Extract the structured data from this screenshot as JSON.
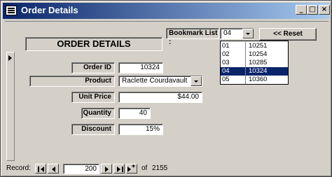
{
  "window": {
    "title": "Order Details",
    "minimize_glyph": "_",
    "maximize_glyph": "□",
    "close_glyph": "×"
  },
  "form": {
    "heading": "ORDER DETAILS",
    "fields": {
      "order_id": {
        "label": "Order ID",
        "value": "10324"
      },
      "product": {
        "label": "Product",
        "value": "Raclette Courdavault"
      },
      "unit_price": {
        "label": "Unit Price",
        "value": "$44.00"
      },
      "quantity": {
        "label": "Quantity",
        "value": "40"
      },
      "discount": {
        "label": "Discount",
        "value": "15%"
      }
    }
  },
  "bookmark": {
    "label": "Bookmark List :",
    "selected": "04",
    "reset_label": "<< Reset",
    "options": [
      {
        "num": "01",
        "order": "10251"
      },
      {
        "num": "02",
        "order": "10254"
      },
      {
        "num": "03",
        "order": "10285"
      },
      {
        "num": "04",
        "order": "10324"
      },
      {
        "num": "05",
        "order": "10360"
      }
    ]
  },
  "navigation": {
    "record_label": "Record:",
    "current": "200",
    "of_label": "of",
    "total": "2155"
  },
  "icons": {
    "window_icon": "form-icon",
    "record_selector": "current-record-arrow-icon",
    "first": "first-record-icon",
    "prev": "previous-record-icon",
    "next": "next-record-icon",
    "last": "last-record-icon",
    "new": "new-record-icon"
  },
  "colors": {
    "title_start": "#0a246a",
    "title_end": "#a6caf0",
    "face": "#d4d0c8",
    "selection": "#0a246a"
  }
}
